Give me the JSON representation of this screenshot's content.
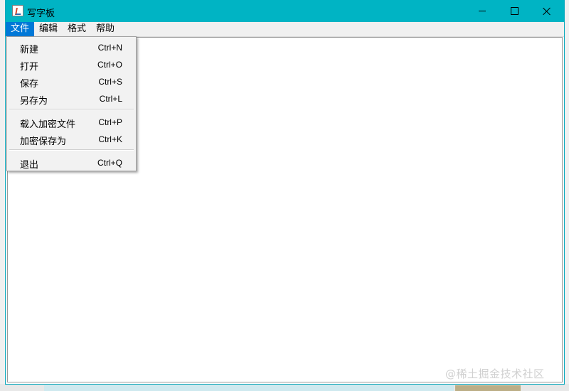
{
  "window": {
    "title": "写字板",
    "icon": "java-coffee-icon",
    "controls": [
      "minimize-icon",
      "maximize-icon",
      "close-icon"
    ],
    "accent": "#00b4c4"
  },
  "menubar": {
    "items": [
      "文件",
      "编辑",
      "格式",
      "帮助"
    ],
    "active_index": 0,
    "highlight": "#0078d7"
  },
  "file_menu": {
    "items": [
      {
        "label": "新建",
        "shortcut": "Ctrl+N"
      },
      {
        "label": "打开",
        "shortcut": "Ctrl+O"
      },
      {
        "label": "保存",
        "shortcut": "Ctrl+S"
      },
      {
        "label": "另存为",
        "shortcut": "Ctrl+L"
      },
      {
        "label": "载入加密文件",
        "shortcut": "Ctrl+P"
      },
      {
        "label": "加密保存为",
        "shortcut": "Ctrl+K"
      },
      {
        "label": "退出",
        "shortcut": "Ctrl+Q"
      }
    ]
  },
  "editor": {
    "content": ""
  },
  "watermark": "@稀土掘金技术社区"
}
